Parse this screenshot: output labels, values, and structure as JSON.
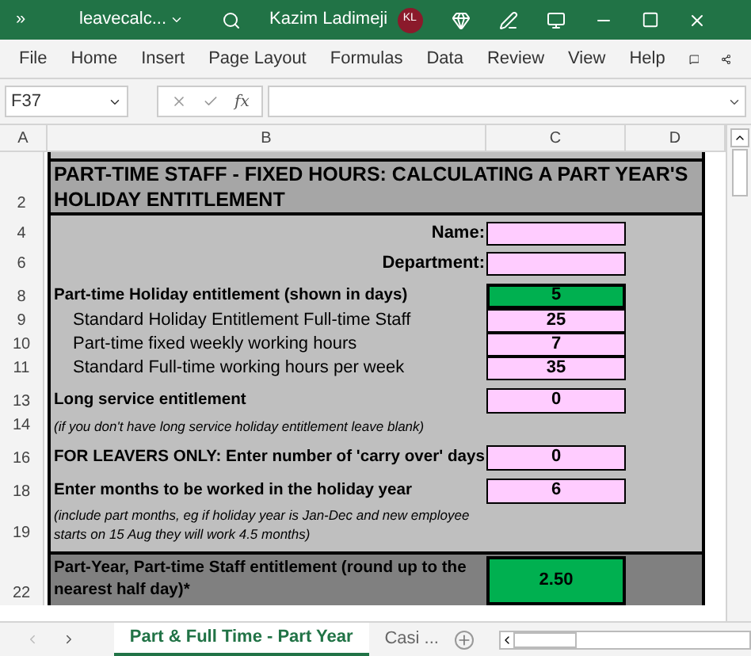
{
  "title_bar": {
    "overflow": "»",
    "file_name": "leavecalc...",
    "user_name": "Kazim Ladimeji",
    "user_initials": "KL"
  },
  "ribbon_tabs": [
    "File",
    "Home",
    "Insert",
    "Page Layout",
    "Formulas",
    "Data",
    "Review",
    "View",
    "Help"
  ],
  "formula_bar": {
    "name_box": "F37",
    "function_label": "fx"
  },
  "columns": [
    "A",
    "B",
    "C",
    "D"
  ],
  "rows": [
    {
      "kind": "gap"
    },
    {
      "number": "2",
      "kind": "title",
      "label": "PART-TIME STAFF - FIXED HOURS: CALCULATING A PART YEAR'S HOLIDAY ENTITLEMENT"
    },
    {
      "kind": "gap"
    },
    {
      "number": "4",
      "kind": "field",
      "label": "Name:",
      "color": "#ffccff"
    },
    {
      "kind": "gap"
    },
    {
      "number": "6",
      "kind": "field",
      "label": "Department:",
      "color": "#ffccff"
    },
    {
      "kind": "gap"
    },
    {
      "number": "8",
      "kind": "heading",
      "label": "Part-time Holiday entitlement (shown in days)",
      "value": "5",
      "color": "#00b050"
    },
    {
      "number": "9",
      "kind": "sub",
      "label": "Standard Holiday Entitlement Full-time Staff",
      "value": "25",
      "color": "#ffccff"
    },
    {
      "number": "10",
      "kind": "sub",
      "label": "Part-time fixed weekly working hours",
      "value": "7",
      "color": "#ffccff"
    },
    {
      "number": "11",
      "kind": "sub",
      "label": "Standard Full-time working hours per week",
      "value": "35",
      "color": "#ffccff"
    },
    {
      "kind": "gap"
    },
    {
      "number": "13",
      "kind": "heading",
      "label": "Long service entitlement",
      "value": "0",
      "color": "#ffccff"
    },
    {
      "number": "14",
      "kind": "note",
      "label": "(if you don't have long service holiday entitlement leave blank)"
    },
    {
      "kind": "gap"
    },
    {
      "number": "16",
      "kind": "heading",
      "label": "FOR LEAVERS ONLY: Enter number of 'carry over' days",
      "value": "0",
      "color": "#ffccff"
    },
    {
      "kind": "gap"
    },
    {
      "number": "18",
      "kind": "heading",
      "label": "Enter months to be worked in the holiday year",
      "value": "6",
      "color": "#ffccff"
    },
    {
      "number": "19",
      "kind": "note",
      "label": "(include part months, eg if holiday year is Jan-Dec and new employee starts on 15 Aug  they will work 4.5 months)"
    },
    {
      "kind": "gap"
    },
    {
      "number": "22",
      "kind": "result",
      "label": "Part-Year, Part-time Staff entitlement (round up to the nearest half day)*",
      "value": "2.50",
      "color": "#00b050"
    }
  ],
  "sheet_tabs": [
    {
      "label": "Part & Full Time - Part Year",
      "selected": true
    },
    {
      "label": "Casi ...",
      "selected": false
    }
  ]
}
